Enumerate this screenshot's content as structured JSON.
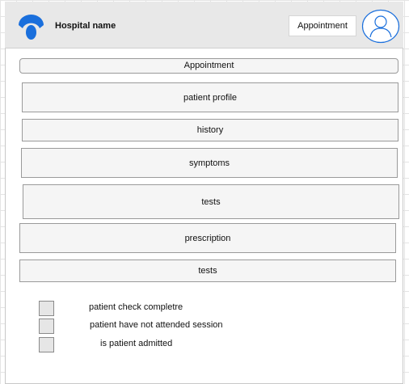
{
  "header": {
    "hospital_name": "Hospital name",
    "appointment_button": "Appointment",
    "logo_icon": "hospital-logo-icon",
    "avatar_icon": "user-avatar-icon",
    "accent_color": "#1a6fdc"
  },
  "main": {
    "section_title": "Appointment",
    "rows": [
      "patient profile",
      "history",
      "symptoms",
      "tests",
      "prescription",
      "tests"
    ]
  },
  "checklist": [
    "patient check completre",
    "patient have not attended session",
    "is patient admitted"
  ]
}
